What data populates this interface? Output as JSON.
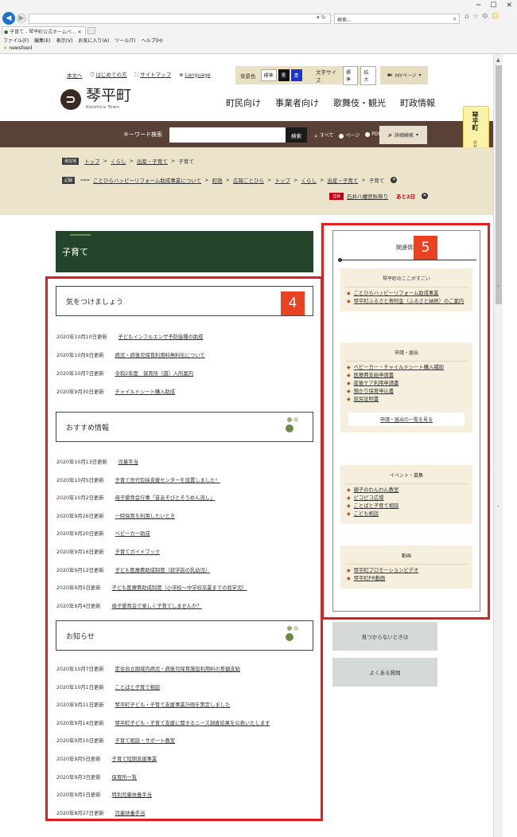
{
  "browser": {
    "tab_title": "子育て - 琴平町公式ホームペ...",
    "search_placeholder": "検索...",
    "menu": [
      "ファイル(F)",
      "編集(E)",
      "表示(V)",
      "お気に入り(A)",
      "ツール(T)",
      "ヘルプ(H)"
    ],
    "favorites": "newsfeed"
  },
  "utility": {
    "skip": "本文へ",
    "first_time": "はじめての方",
    "sitemap": "サイトマップ",
    "language": "Language",
    "bg_label": "背景色",
    "bg_standard": "標準",
    "bg_black": "黒",
    "bg_blue": "青",
    "font_label": "文字サイズ",
    "font_standard": "標準",
    "font_large": "拡大",
    "mypage": "MYページ"
  },
  "logo": {
    "name": "琴平町",
    "sub": "Kotohira Town"
  },
  "mainnav": [
    "町民向け",
    "事業者向け",
    "歌舞伎・観光",
    "町政情報"
  ],
  "sidetab": {
    "title": "琴平町",
    "sub": "のおすすめ",
    "open": "開く"
  },
  "search": {
    "label": "キーワード検索",
    "button": "検索",
    "options": [
      "すべて",
      "ページ",
      "PDF"
    ],
    "detail": "詳細検索"
  },
  "breadcrumb": {
    "current_tag": "現在地",
    "current": [
      "トップ",
      "くらし",
      "出産・子育て",
      "子育て"
    ],
    "history_tag": "記録",
    "history": [
      "ことひらハッピーリフォーム助成事業について",
      "町政",
      "広報ことひら",
      "トップ",
      "くらし",
      "出産・子育て",
      "子育て"
    ]
  },
  "notice": {
    "tag": "注目",
    "text": "石井八幡宮秋祭り",
    "days": "あと2日"
  },
  "page_title": "子育て",
  "labels": {
    "box4": "4",
    "box5": "5"
  },
  "sections": [
    {
      "heading": "気をつけましょう",
      "items": [
        {
          "date": "2020年10月10日更新",
          "title": "子どもインフルエンザ予防接種の助成"
        },
        {
          "date": "2020年10月9日更新",
          "title": "病児・病後児保育利用料無料化について"
        },
        {
          "date": "2020年10月7日更新",
          "title": "令和2年度　保育所（園）入所案内"
        },
        {
          "date": "2020年9月30日更新",
          "title": "チャイルドシート購入助成"
        }
      ]
    },
    {
      "heading": "おすすめ情報",
      "items": [
        {
          "date": "2020年10月13日更新",
          "title": "児童手当"
        },
        {
          "date": "2020年10月5日更新",
          "title": "子育て世代包括支援センターを設置しました！"
        },
        {
          "date": "2020年10月2日更新",
          "title": "母子愛育会行事「昔あそびとそうめん流し」"
        },
        {
          "date": "2020年9月26日更新",
          "title": "一時保育を利用したいとき"
        },
        {
          "date": "2020年9月20日更新",
          "title": "ベビーカー助成"
        },
        {
          "date": "2020年9月16日更新",
          "title": "子育てガイドブック"
        },
        {
          "date": "2020年9月12日更新",
          "title": "子ども医療費助成制度（就学前の乳幼児）"
        },
        {
          "date": "2020年9月5日更新",
          "title": "子ども医療費助成制度（小学校〜中学校卒業までの就学児）"
        },
        {
          "date": "2020年9月4日更新",
          "title": "母子愛育会で楽しく子育てしませんか？"
        }
      ]
    },
    {
      "heading": "お知らせ",
      "items": [
        {
          "date": "2020年10月7日更新",
          "title": "定住自立圏域内病児・病後児保育施設利用料の差額支給"
        },
        {
          "date": "2020年10月1日更新",
          "title": "ことばと子育て相談"
        },
        {
          "date": "2020年9月21日更新",
          "title": "琴平町子ども・子育て支援事業計画を策定しました"
        },
        {
          "date": "2020年9月14日更新",
          "title": "琴平町子ども・子育て支援に関するニーズ調査結果を公表いたします"
        },
        {
          "date": "2020年9月10日更新",
          "title": "子育て相談・サポート教室"
        },
        {
          "date": "2020年9月5日更新",
          "title": "子育て短期支援事業"
        },
        {
          "date": "2020年9月3日更新",
          "title": "保育所一覧"
        },
        {
          "date": "2020年9月1日更新",
          "title": "特別児童扶養手当"
        },
        {
          "date": "2020年8月27日更新",
          "title": "児童扶養手当"
        }
      ]
    }
  ],
  "related": {
    "title": "関連情報",
    "groups": [
      {
        "title": "琴平町のここがすごい",
        "items": [
          "ことひらハッピーリフォーム助成事業",
          "琴平町ふるさと寄附金（ふるさと納税）のご案内"
        ]
      },
      {
        "title": "申請・届出",
        "items": [
          "ベビーカー・チャイルドシート購入補助",
          "医療費支給申請書",
          "産後ケア利用申請書",
          "預かり保育申込書",
          "就労証明書"
        ],
        "more": "申請・届出の一覧を見る"
      },
      {
        "title": "イベント・募集",
        "items": [
          "親子のわんわん教室",
          "ピコピコ広場",
          "ことばと子育て相談",
          "こども相談"
        ]
      },
      {
        "title": "動画",
        "items": [
          "琴平町プロモーションビデオ",
          "琴平町PR動画"
        ]
      }
    ]
  },
  "side_buttons": [
    "見つからないときは",
    "よくある質問"
  ]
}
